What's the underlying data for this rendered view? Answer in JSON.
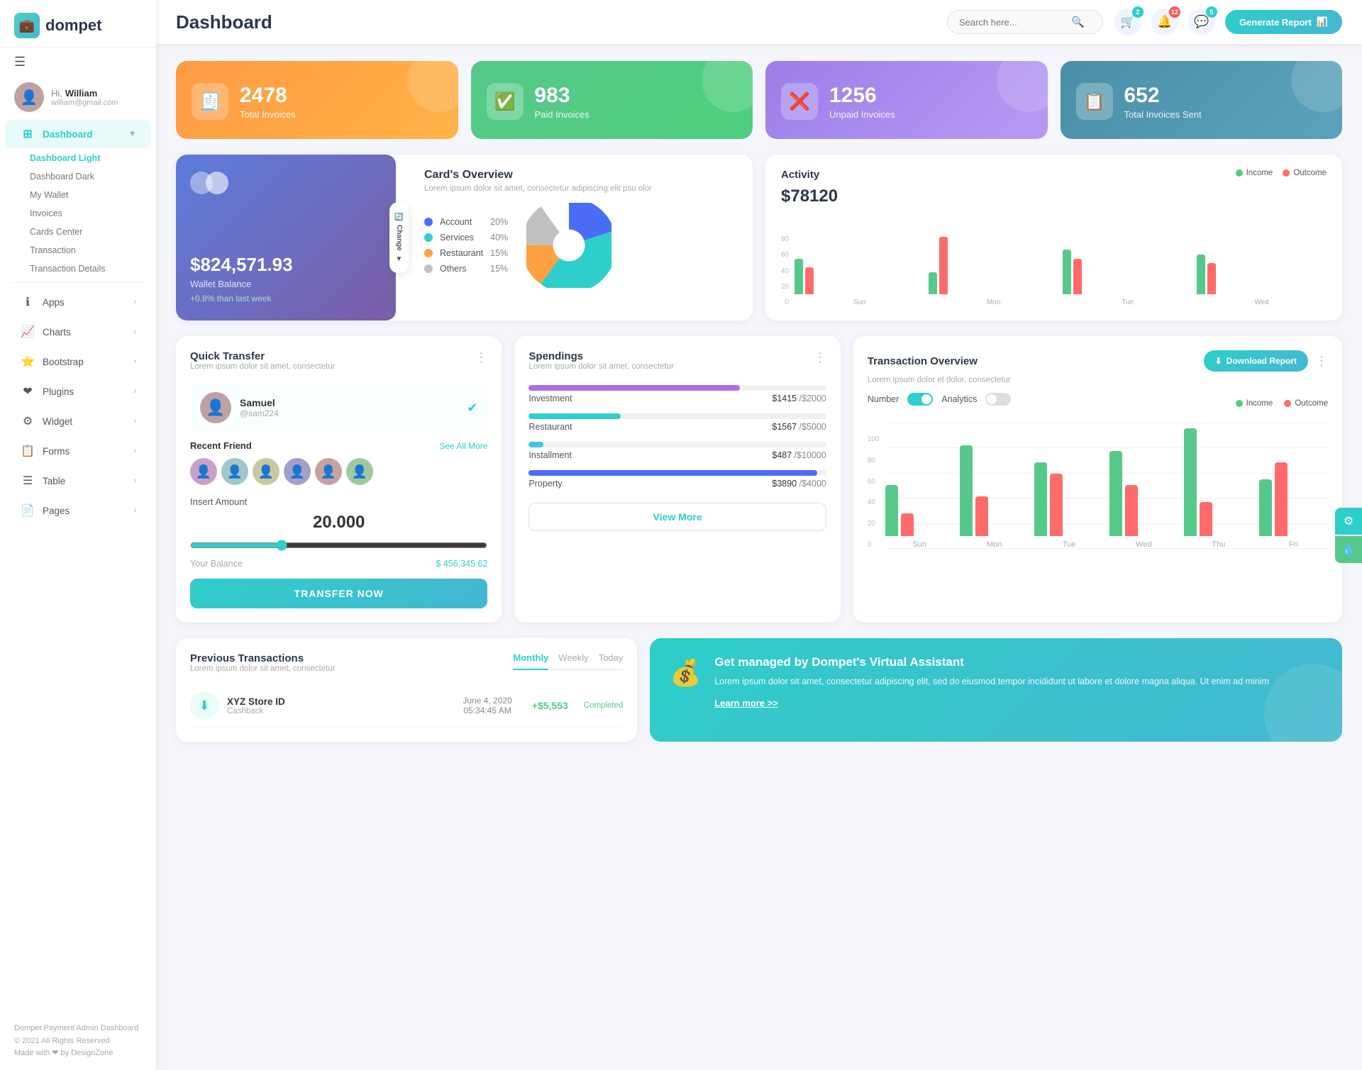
{
  "app": {
    "logo_icon": "💼",
    "logo_text": "dompet",
    "page_title": "Dashboard"
  },
  "header": {
    "search_placeholder": "Search here...",
    "generate_report_label": "Generate Report",
    "badge_cart": "2",
    "badge_bell": "12",
    "badge_chat": "5"
  },
  "user": {
    "greeting": "Hi,",
    "name": "William",
    "email": "william@gmail.com"
  },
  "sidebar": {
    "nav_items": [
      {
        "label": "Dashboard",
        "icon": "⊞",
        "active": true,
        "has_arrow": true
      },
      {
        "label": "Apps",
        "icon": "ℹ",
        "active": false,
        "has_arrow": true
      },
      {
        "label": "Charts",
        "icon": "📈",
        "active": false,
        "has_arrow": true
      },
      {
        "label": "Bootstrap",
        "icon": "⭐",
        "active": false,
        "has_arrow": true
      },
      {
        "label": "Plugins",
        "icon": "❤",
        "active": false,
        "has_arrow": true
      },
      {
        "label": "Widget",
        "icon": "⚙",
        "active": false,
        "has_arrow": true
      },
      {
        "label": "Forms",
        "icon": "📋",
        "active": false,
        "has_arrow": true
      },
      {
        "label": "Table",
        "icon": "☰",
        "active": false,
        "has_arrow": true
      },
      {
        "label": "Pages",
        "icon": "📄",
        "active": false,
        "has_arrow": true
      }
    ],
    "sub_items": [
      {
        "label": "Dashboard Light",
        "active": true
      },
      {
        "label": "Dashboard Dark",
        "active": false
      },
      {
        "label": "My Wallet",
        "active": false
      },
      {
        "label": "Invoices",
        "active": false
      },
      {
        "label": "Cards Center",
        "active": false
      },
      {
        "label": "Transaction",
        "active": false
      },
      {
        "label": "Transaction Details",
        "active": false
      }
    ],
    "footer": {
      "brand": "Dompet Payment Admin Dashboard",
      "copyright": "© 2021 All Rights Reserved",
      "made_with": "Made with ❤ by DesignZone"
    }
  },
  "stat_cards": [
    {
      "number": "2478",
      "label": "Total Invoices",
      "icon": "🧾",
      "color": "orange"
    },
    {
      "number": "983",
      "label": "Paid Invoices",
      "icon": "✅",
      "color": "green"
    },
    {
      "number": "1256",
      "label": "Unpaid Invoices",
      "icon": "❌",
      "color": "purple"
    },
    {
      "number": "652",
      "label": "Total Invoices Sent",
      "icon": "📋",
      "color": "teal"
    }
  ],
  "wallet_card": {
    "amount": "$824,571.93",
    "label": "Wallet Balance",
    "change": "+0.8% than last week",
    "change_btn_label": "Change"
  },
  "card_overview": {
    "title": "Card's Overview",
    "subtitle": "Lorem ipsum dolor sit amet, consectetur adipiscing elit psu olor",
    "rows": [
      {
        "color": "blue",
        "label": "Account",
        "pct": "20%"
      },
      {
        "color": "teal",
        "label": "Services",
        "pct": "40%"
      },
      {
        "color": "orange",
        "label": "Restaurant",
        "pct": "15%"
      },
      {
        "color": "gray",
        "label": "Others",
        "pct": "15%"
      }
    ]
  },
  "activity": {
    "title": "Activity",
    "amount": "$78120",
    "legend": [
      {
        "color": "green",
        "label": "Income"
      },
      {
        "color": "red",
        "label": "Outcome"
      }
    ],
    "bars": [
      {
        "day": "Sun",
        "income": 40,
        "outcome": 30
      },
      {
        "day": "Mon",
        "income": 25,
        "outcome": 65
      },
      {
        "day": "Tue",
        "income": 50,
        "outcome": 40
      },
      {
        "day": "Wed",
        "income": 45,
        "outcome": 35
      }
    ]
  },
  "quick_transfer": {
    "title": "Quick Transfer",
    "subtitle": "Lorem ipsum dolor sit amet, consectetur",
    "user_name": "Samuel",
    "user_id": "@sam224",
    "recent_label": "Recent Friend",
    "see_all": "See All More",
    "insert_label": "Insert Amount",
    "amount": "20.000",
    "balance_label": "Your Balance",
    "balance": "$ 456,345.62",
    "btn_label": "TRANSFER NOW"
  },
  "spendings": {
    "title": "Spendings",
    "subtitle": "Lorem ipsum dolor sit amet, consectetur",
    "view_more": "View More",
    "items": [
      {
        "name": "Investment",
        "amount": "$1415",
        "total": "/$2000",
        "pct": 71,
        "color": "#b06fe0"
      },
      {
        "name": "Restaurant",
        "amount": "$1567",
        "total": "/$5000",
        "pct": 31,
        "color": "#2ececa"
      },
      {
        "name": "Installment",
        "amount": "$487",
        "total": "/$10000",
        "pct": 5,
        "color": "#45c5e0"
      },
      {
        "name": "Property",
        "amount": "$3890",
        "total": "/$4000",
        "pct": 97,
        "color": "#4a6cf7"
      }
    ]
  },
  "transaction_overview": {
    "title": "Transaction Overview",
    "subtitle": "Lorem ipsum dolor et dolor, consectetur",
    "download_label": "Download Report",
    "toggle_number": "Number",
    "toggle_analytics": "Analytics",
    "legend_income": "Income",
    "legend_outcome": "Outcome",
    "bars": [
      {
        "day": "Sun",
        "income": 45,
        "outcome": 20
      },
      {
        "day": "Mon",
        "income": 80,
        "outcome": 35
      },
      {
        "day": "Tue",
        "income": 65,
        "outcome": 55
      },
      {
        "day": "Wed",
        "income": 75,
        "outcome": 45
      },
      {
        "day": "Thu",
        "income": 95,
        "outcome": 30
      },
      {
        "day": "Fri",
        "income": 50,
        "outcome": 65
      }
    ],
    "y_labels": [
      "100",
      "80",
      "60",
      "40",
      "20",
      "0"
    ]
  },
  "prev_transactions": {
    "title": "Previous Transactions",
    "subtitle": "Lorem ipsum dolor sit amet, consectetur",
    "tabs": [
      "Monthly",
      "Weekly",
      "Today"
    ],
    "active_tab": "Monthly",
    "items": [
      {
        "name": "XYZ Store ID",
        "type": "Cashback",
        "date": "June 4, 2020",
        "time": "05:34:45 AM",
        "amount": "+$5,553",
        "status": "Completed",
        "icon": "⬇",
        "icon_color": "#2ececa"
      }
    ]
  },
  "virtual_assistant": {
    "title": "Get managed by Dompet's Virtual Assistant",
    "description": "Lorem ipsum dolor sit amet, consectetur adipiscing elit, sed do eiusmod tempor incididunt ut labore et dolore magna aliqua. Ut enim ad minim",
    "link": "Learn more >>"
  }
}
